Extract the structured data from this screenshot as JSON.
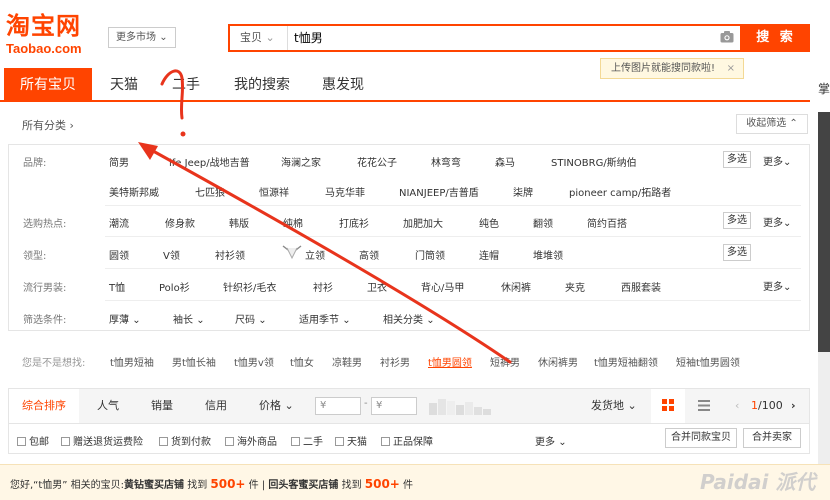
{
  "logo": {
    "cn": "淘宝网",
    "en": "Taobao.com"
  },
  "header": {
    "more_market": "更多市场"
  },
  "search": {
    "category": "宝贝",
    "query": "t恤男",
    "button": "搜 索",
    "tip": "上传图片就能搜同款啦!",
    "tip_close": "×"
  },
  "tabs": [
    "所有宝贝",
    "天猫",
    "二手",
    "我的搜索",
    "惠发现"
  ],
  "cutoff_text": "掌",
  "breadcrumb": "所有分类",
  "collapse": "收起筛选",
  "filters": {
    "brand_label": "品牌:",
    "brands_row1": [
      "简男",
      "ife Jeep/战地吉普",
      "海澜之家",
      "花花公子",
      "林弯弯",
      "森马",
      "STINOBRG/斯纳伯"
    ],
    "brands_row2": [
      "美特斯邦威",
      "七匹狼",
      "恒源祥",
      "马克华菲",
      "NIANJEEP/吉普盾",
      "柒牌",
      "pioneer camp/拓路者"
    ],
    "hot_label": "选购热点:",
    "hot": [
      "潮流",
      "修身款",
      "韩版",
      "纯棉",
      "打底衫",
      "加肥加大",
      "纯色",
      "翻领",
      "简约百搭"
    ],
    "collar_label": "领型:",
    "collar": [
      "圆领",
      "V领",
      "衬衫领",
      "立领",
      "高领",
      "门筒领",
      "连帽",
      "堆堆领"
    ],
    "trend_label": "流行男装:",
    "trend": [
      "T恤",
      "Polo衫",
      "针织衫/毛衣",
      "衬衫",
      "卫衣",
      "背心/马甲",
      "休闲裤",
      "夹克",
      "西服套装"
    ],
    "cond_label": "筛选条件:",
    "cond": [
      "厚薄",
      "袖长",
      "尺码",
      "适用季节",
      "相关分类"
    ],
    "multi": "多选",
    "more": "更多"
  },
  "suggest": {
    "label": "您是不是想找:",
    "items": [
      "t恤男短袖",
      "男t恤长袖",
      "t恤男v领",
      "t恤女",
      "凉鞋男",
      "衬衫男",
      "t恤男圆领",
      "短裤男",
      "休闲裤男",
      "t恤男短袖翻领",
      "短袖t恤男圆领"
    ],
    "highlight_index": 6
  },
  "sort": {
    "items": [
      "综合排序",
      "人气",
      "销量",
      "信用",
      "价格"
    ],
    "price_from": "¥",
    "price_to": "¥",
    "dash": "-",
    "ship_from": "发货地",
    "page": "1/100",
    "page_current": "1",
    "page_total": "/100"
  },
  "options": [
    "包邮",
    "赠送退货运费险",
    "货到付款",
    "海外商品",
    "二手",
    "天猫",
    "正品保障"
  ],
  "options_more": "更多",
  "buttons": {
    "merge_same": "合并同款宝贝",
    "merge_seller": "合并卖家"
  },
  "notice": {
    "pre": "您好,“t恤男” 相关的宝贝:",
    "shop1": "黄钻蜜买店铺",
    "found1": " 找到 ",
    "n1": "500+",
    "unit1": " 件 | ",
    "shop2": "回头客蜜买店铺",
    "found2": " 找到 ",
    "n2": "500+",
    "unit2": " 件"
  },
  "watermark": "Paidai 派代",
  "colors": {
    "brand": "#ff4400",
    "annotation": "#e8341c"
  }
}
